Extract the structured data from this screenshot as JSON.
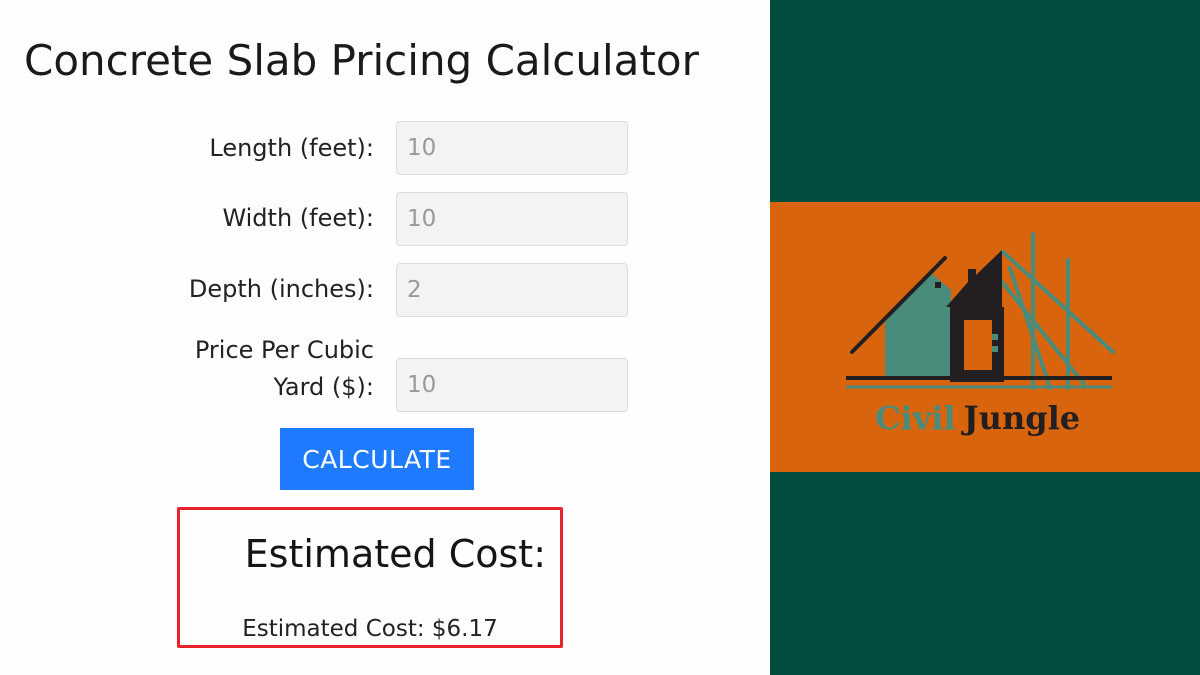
{
  "calculator": {
    "title": "Concrete Slab Pricing Calculator",
    "fields": [
      {
        "label": "Length (feet):",
        "value": "10"
      },
      {
        "label": "Width (feet):",
        "value": "10"
      },
      {
        "label": "Depth (inches):",
        "value": "2"
      },
      {
        "label": "Price Per Cubic Yard ($):",
        "value": "10"
      }
    ],
    "button_label": "CALCULATE",
    "result": {
      "heading": "Estimated Cost:",
      "text": "Estimated Cost: $6.17"
    }
  },
  "brand": {
    "name_part1": "Civil",
    "name_part2": "Jungle",
    "colors": {
      "background": "#004d40",
      "band": "#d8650d",
      "teal": "#4a8c7c",
      "dark": "#231f20"
    }
  },
  "colors": {
    "button": "#1e7bff",
    "result_border": "#e8232b"
  }
}
